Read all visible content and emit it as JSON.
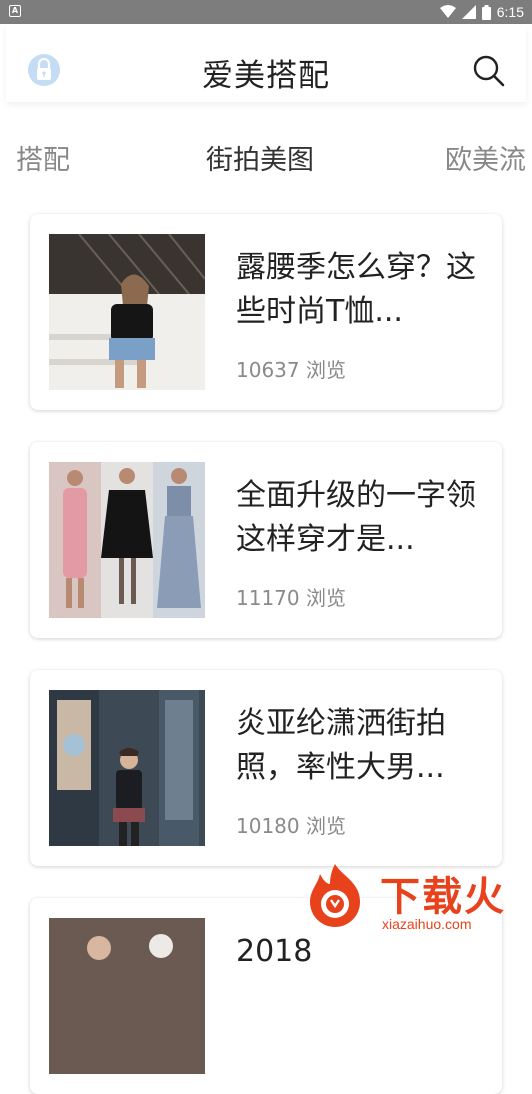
{
  "status_bar": {
    "time": "6:15",
    "app_badge": "A"
  },
  "header": {
    "title": "爱美搭配",
    "left_icon": "lock-icon",
    "right_icon": "search-icon"
  },
  "tabs": [
    {
      "label": "搭配",
      "active": false
    },
    {
      "label": "街拍美图",
      "active": true
    },
    {
      "label": "欧美流",
      "active": false
    }
  ],
  "articles": [
    {
      "title": "露腰季怎么穿？这些时尚T恤...",
      "views": "10637 浏览"
    },
    {
      "title": "全面升级的一字领 这样穿才是...",
      "views": "11170 浏览"
    },
    {
      "title": "炎亚纶潇洒街拍照，率性大男...",
      "views": "10180 浏览"
    },
    {
      "title": "2018",
      "views": ""
    }
  ],
  "watermark": {
    "text": "下载火",
    "sub": "xiazaihuo.com"
  },
  "colors": {
    "status_bar": "#7d7d7d",
    "accent_watermark": "#e8421c",
    "lock_bg": "#c4dcf4"
  }
}
